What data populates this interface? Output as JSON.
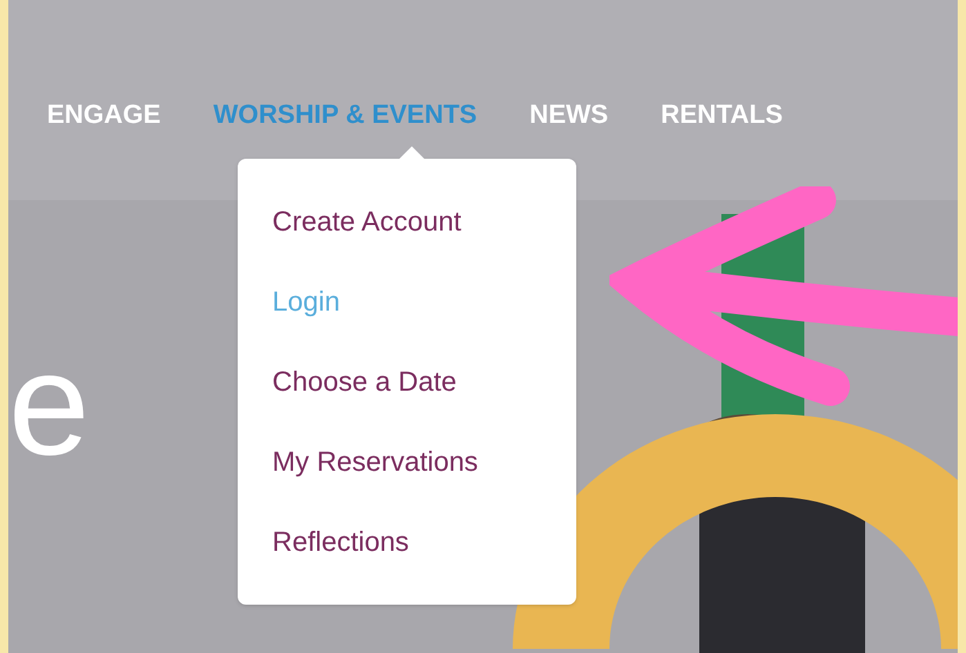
{
  "nav": [
    {
      "label": "ENGAGE",
      "selected": false
    },
    {
      "label": "WORSHIP & EVENTS",
      "selected": true
    },
    {
      "label": "NEWS",
      "selected": false
    },
    {
      "label": "RENTALS",
      "selected": false
    }
  ],
  "dropdown": [
    {
      "label": "Create Account",
      "selected": false
    },
    {
      "label": "Login",
      "selected": true
    },
    {
      "label": "Choose a Date",
      "selected": false
    },
    {
      "label": "My Reservations",
      "selected": false
    },
    {
      "label": "Reflections",
      "selected": false
    }
  ],
  "hero": {
    "heading": "e"
  }
}
